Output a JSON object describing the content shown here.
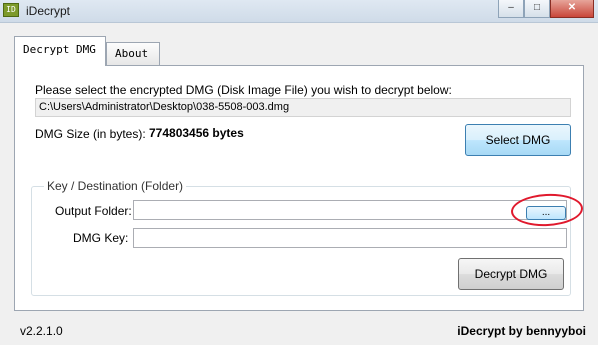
{
  "window": {
    "title": "iDecrypt",
    "icon": "app-icon",
    "controls": {
      "minimize": "–",
      "maximize": "□",
      "close": "✕"
    }
  },
  "tabs": [
    {
      "label": "Decrypt DMG",
      "active": true
    },
    {
      "label": "About",
      "active": false
    }
  ],
  "decrypt": {
    "instruction": "Please select the encrypted DMG (Disk Image File) you wish to decrypt below:",
    "file_path": "C:\\Users\\Administrator\\Desktop\\038-5508-003.dmg",
    "size_label": "DMG Size (in bytes):",
    "size_value": "774803456 bytes",
    "select_button": "Select DMG",
    "group_title": "Key / Destination (Folder)",
    "output_folder_label": "Output Folder:",
    "output_folder_value": "",
    "browse_button": "...",
    "dmg_key_label": "DMG Key:",
    "dmg_key_value": "",
    "decrypt_button": "Decrypt DMG"
  },
  "footer": {
    "version": "v2.2.1.0",
    "credit": "iDecrypt by bennyyboi"
  },
  "colors": {
    "annotation": "#e0192d",
    "accent": "#3c7fb1"
  }
}
